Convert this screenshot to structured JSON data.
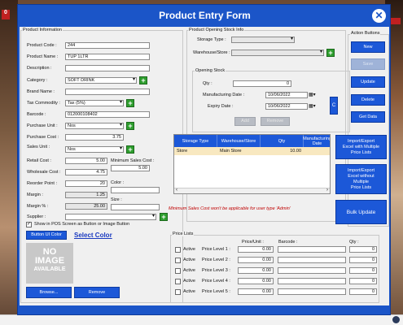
{
  "window": {
    "title": "Product Entry Form",
    "close_glyph": "✕"
  },
  "background": {
    "left_badge": "0"
  },
  "product_info": {
    "group_title": "Product Information",
    "fields": {
      "product_code": {
        "label": "Product Code :",
        "value": "244"
      },
      "product_name": {
        "label": "Product Name :",
        "value": "TUP 1LTR"
      },
      "description": {
        "label": "Description :",
        "value": ""
      },
      "category": {
        "label": "Category :",
        "value": "SOFT DRINK"
      },
      "brand_name": {
        "label": "Brand Name :",
        "value": ""
      },
      "tax_commodity": {
        "label": "Tax Commodity :",
        "value": "Tax (5%)"
      },
      "barcode": {
        "label": "Barcode :",
        "value": "012000108402"
      },
      "purchase_unit": {
        "label": "Purchase Unit :",
        "value": "Nos"
      },
      "purchase_cost": {
        "label": "Purchase Cost :",
        "value": "3.75"
      },
      "sales_unit": {
        "label": "Sales Unit :",
        "value": "Nos"
      },
      "retail_cost": {
        "label": "Retail Cost :",
        "value": "5.00"
      },
      "min_sales_cost": {
        "label": "Minimum Sales Cost :",
        "value": "5.00"
      },
      "wholesale_cost": {
        "label": "Wholesale Cost :",
        "value": "4.75"
      },
      "reorder_point": {
        "label": "Reorder Point :",
        "value": "20"
      },
      "color": {
        "label": "Color :",
        "value": ""
      },
      "margin": {
        "label": "Margin :",
        "value": "1.25"
      },
      "margin_pct": {
        "label": "Margin % :",
        "value": "25.00"
      },
      "size": {
        "label": "Size :",
        "value": ""
      },
      "supplier": {
        "label": "Supplier :",
        "value": ""
      }
    },
    "show_in_pos_label": "Show in POS Screen as Button or Image Button",
    "show_in_pos_checked": true,
    "button_ui_color_label": "Button UI Color",
    "select_color_label": "Select Color",
    "no_image_text": [
      "NO",
      "IMAGE",
      "AVAILABLE"
    ],
    "browse_label": "Browse...",
    "remove_label": "Remove"
  },
  "opening_stock_info": {
    "group_title": "Product Opening Stock Info",
    "storage_type_label": "Storage Type :",
    "storage_type_value": "",
    "warehouse_store_label": "Warehouse/Store :",
    "warehouse_store_value": "",
    "opening_stock": {
      "group_title": "Opening Stock",
      "qty_label": "Qty :",
      "qty_value": "0",
      "mfg_date_label": "Manufacturing Date :",
      "mfg_date_value": "10/06/2022",
      "expiry_date_label": "Expiry Date :",
      "expiry_date_value": "10/06/2022",
      "add_label": "Add",
      "remove_label": "Remove",
      "side_button_label": "C"
    },
    "grid": {
      "columns": [
        "Storage Type",
        "Warehouse/Store",
        "Qty",
        "Manufacturing Date"
      ],
      "rows": [
        {
          "storage_type": "Store",
          "warehouse": "Main Store",
          "qty": "10.00",
          "mfg_date": ""
        }
      ]
    },
    "warning_note": "Minimum Sales Cost won't be applicable for user type 'Admin'"
  },
  "price_lists": {
    "group_title": "Price Lists",
    "headers": {
      "price_unit": "Price/Unit :",
      "barcode": "Barcode :",
      "qty": "Qty :"
    },
    "active_label": "Active",
    "levels": [
      {
        "label": "Price Level 1 :",
        "active": false,
        "price": "0.00",
        "barcode": "",
        "qty": "0"
      },
      {
        "label": "Price Level 2 :",
        "active": false,
        "price": "0.00",
        "barcode": "",
        "qty": "0"
      },
      {
        "label": "Price Level 3 :",
        "active": false,
        "price": "0.00",
        "barcode": "",
        "qty": "0"
      },
      {
        "label": "Price Level 4 :",
        "active": false,
        "price": "0.00",
        "barcode": "",
        "qty": "0"
      },
      {
        "label": "Price Level 5 :",
        "active": false,
        "price": "0.00",
        "barcode": "",
        "qty": "0"
      }
    ]
  },
  "action_buttons": {
    "group_title": "Action Buttons",
    "new": "New",
    "save": "Save",
    "update": "Update",
    "delete": "Delete",
    "get_data": "Get Data",
    "import_multi": [
      "Import/Export",
      "Excel with Multiple",
      "Price Lists"
    ],
    "import_no_multi": [
      "Import/Export",
      "Excel without",
      "Multiple",
      "Price Lists"
    ],
    "bulk_update": "Bulk Update"
  },
  "colors": {
    "dialog_blue": "#1b55c8",
    "button_blue": "#1c58d8",
    "add_green": "#2e9e2e",
    "grid_row_highlight": "#f8e8c0",
    "warning_red": "#c00000"
  },
  "icons": {
    "add": "plus-icon",
    "close": "close-icon",
    "calendar": "calendar-icon",
    "dropdown": "chevron-down-icon"
  }
}
